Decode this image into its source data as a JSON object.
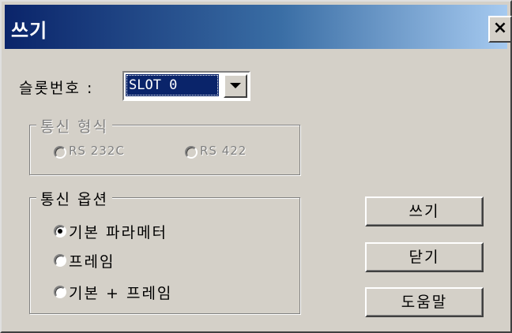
{
  "window": {
    "title": "쓰기",
    "close_symbol": "×",
    "title_gradient": [
      "#0a246a",
      "#a6caf0"
    ],
    "face_color": "#d4d0c8"
  },
  "slot": {
    "label": "슬롯번호 :",
    "selected": "SLOT 0"
  },
  "comm_format": {
    "title": "통신 형식",
    "enabled": false,
    "options": [
      {
        "label": "RS 232C",
        "checked": false
      },
      {
        "label": "RS 422",
        "checked": false
      }
    ]
  },
  "comm_option": {
    "title": "통신 옵션",
    "options": [
      {
        "label": "기본 파라메터",
        "checked": true
      },
      {
        "label": "프레임",
        "checked": false
      },
      {
        "label": "기본 + 프레임",
        "checked": false
      }
    ]
  },
  "buttons": {
    "write": "쓰기",
    "close": "닫기",
    "help": "도움말"
  },
  "icons": {
    "combo_arrow": "chevron-down-icon",
    "close": "close-icon"
  }
}
